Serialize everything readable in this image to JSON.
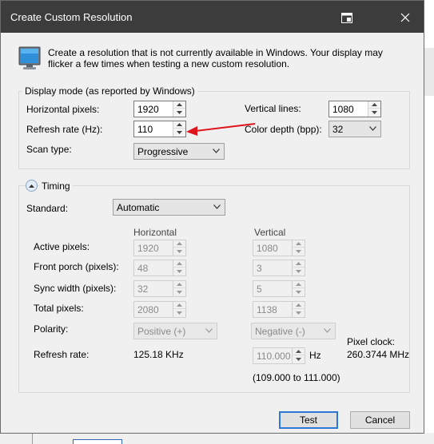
{
  "window": {
    "title": "Create Custom Resolution"
  },
  "intro": "Create a resolution that is not currently available in Windows. Your display may flicker a few times when testing a new custom resolution.",
  "display_mode": {
    "group_label": "Display mode (as reported by Windows)",
    "horizontal_pixels": {
      "label": "Horizontal pixels:",
      "value": "1920"
    },
    "vertical_lines": {
      "label": "Vertical lines:",
      "value": "1080"
    },
    "refresh_rate": {
      "label": "Refresh rate (Hz):",
      "value": "110"
    },
    "color_depth": {
      "label": "Color depth (bpp):",
      "value": "32"
    },
    "scan_type": {
      "label": "Scan type:",
      "value": "Progressive"
    }
  },
  "timing": {
    "group_label": "Timing",
    "standard": {
      "label": "Standard:",
      "value": "Automatic"
    },
    "col_horizontal": "Horizontal",
    "col_vertical": "Vertical",
    "rows": {
      "active": {
        "label": "Active pixels:",
        "h": "1920",
        "v": "1080"
      },
      "front_porch": {
        "label": "Front porch (pixels):",
        "h": "48",
        "v": "3"
      },
      "sync_width": {
        "label": "Sync width (pixels):",
        "h": "32",
        "v": "5"
      },
      "total": {
        "label": "Total pixels:",
        "h": "2080",
        "v": "1138"
      }
    },
    "polarity": {
      "label": "Polarity:",
      "h": "Positive (+)",
      "v": "Negative (-)"
    },
    "refresh": {
      "label": "Refresh rate:",
      "h": "125.18 KHz",
      "v": "110.000",
      "unit": "Hz",
      "range": "(109.000 to 111.000)"
    },
    "pixel_clock": {
      "label": "Pixel clock:",
      "value": "260.3744 MHz"
    }
  },
  "buttons": {
    "test": "Test",
    "cancel": "Cancel"
  },
  "colors": {
    "titlebar": "#3c3c3c",
    "accent": "#2b77d4",
    "annotation_arrow": "#e0141c"
  }
}
